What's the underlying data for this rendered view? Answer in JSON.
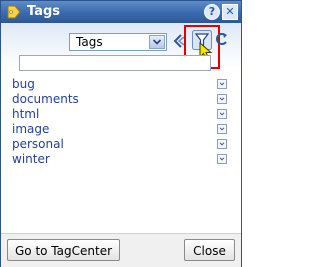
{
  "window": {
    "title": "Tags",
    "help_label": "?",
    "close_label": "✕"
  },
  "toolbar": {
    "tag_select_value": "Tags",
    "filter_input_value": ""
  },
  "tags": [
    {
      "label": "bug"
    },
    {
      "label": "documents"
    },
    {
      "label": "html"
    },
    {
      "label": "image"
    },
    {
      "label": "personal"
    },
    {
      "label": "winter"
    }
  ],
  "footer": {
    "tagcenter_label": "Go to TagCenter",
    "close_label": "Close"
  },
  "colors": {
    "titlebar": "#3a69ad",
    "tag_link": "#24409a",
    "highlight": "#e00000",
    "cursor": "#f2e600"
  }
}
